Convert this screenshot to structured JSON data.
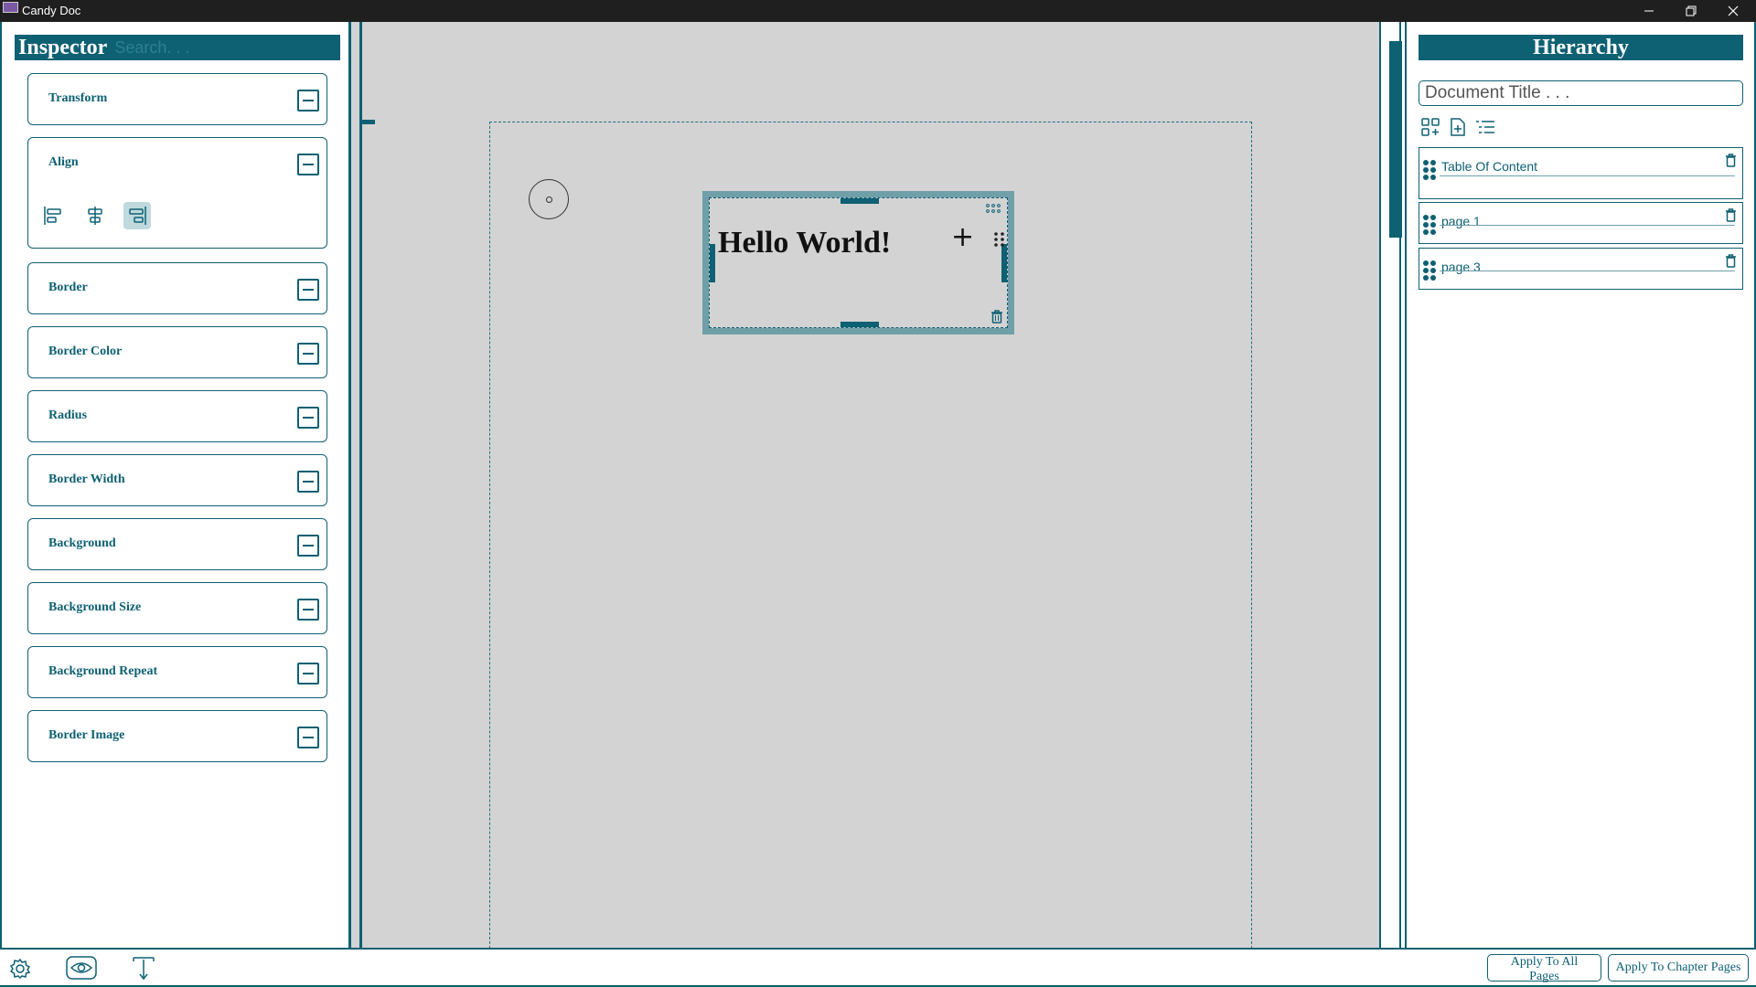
{
  "window": {
    "title": "Candy Doc",
    "controls": [
      "minimize-icon",
      "restore-icon",
      "close-icon"
    ]
  },
  "inspector": {
    "title": "Inspector",
    "search_placeholder": "Search. . .",
    "sections": [
      {
        "label": "Transform"
      },
      {
        "label": "Align",
        "icons": [
          "align-left-icon",
          "align-center-icon",
          "align-right-icon"
        ],
        "active_icon": "align-right-icon"
      },
      {
        "label": "Border"
      },
      {
        "label": "Border Color"
      },
      {
        "label": "Radius"
      },
      {
        "label": "Border Width"
      },
      {
        "label": "Background"
      },
      {
        "label": "Background Size"
      },
      {
        "label": "Background Repeat"
      },
      {
        "label": "Border Image"
      }
    ]
  },
  "canvas": {
    "textbox_text": "Hello World!"
  },
  "hierarchy": {
    "title": "Hierarchy",
    "doc_title_placeholder": "Document Title . . .",
    "tools": [
      "grid-view-icon",
      "add-page-icon",
      "list-view-icon"
    ],
    "items": [
      {
        "name": "Table Of Content"
      },
      {
        "name": "page 1"
      },
      {
        "name": "page 3"
      }
    ]
  },
  "bottom_bar": {
    "icons": [
      "settings-icon",
      "preview-eye-icon",
      "text-tool-icon"
    ],
    "apply_all_label": "Apply To All Pages",
    "apply_chapter_label": "Apply To Chapter Pages"
  },
  "colors": {
    "accent": "#0e6073",
    "canvas_bg": "#d3d3d3",
    "selection_border": "#6f9fa8"
  }
}
